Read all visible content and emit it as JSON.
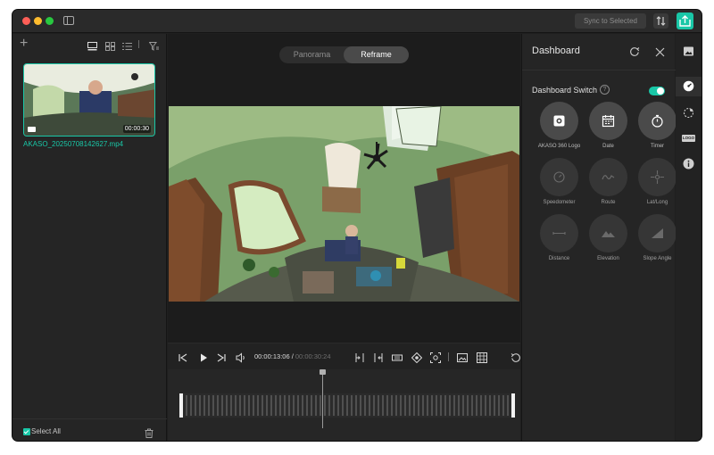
{
  "titlebar": {
    "sync_label": "Sync to Selected"
  },
  "media": {
    "files": [
      {
        "name": "AKASO_20250708142627.mp4",
        "duration": "00:00:30",
        "selected": true
      }
    ],
    "select_all_label": "Select All"
  },
  "viewer": {
    "modes": [
      "Panorama",
      "Reframe"
    ],
    "active_mode": "Reframe"
  },
  "playback": {
    "current_time": "00:00:13:06",
    "separator": " / ",
    "duration": "00:00:30:24"
  },
  "dashboard": {
    "title": "Dashboard",
    "switch_label": "Dashboard Switch",
    "switch_on": true,
    "widgets": [
      {
        "label": "AKASO 360 Logo",
        "icon": "logo-icon",
        "enabled": true
      },
      {
        "label": "Date",
        "icon": "calendar-icon",
        "enabled": true
      },
      {
        "label": "Timer",
        "icon": "stopwatch-icon",
        "enabled": true
      },
      {
        "label": "Speedometer",
        "icon": "speedometer-icon",
        "enabled": false
      },
      {
        "label": "Route",
        "icon": "route-icon",
        "enabled": false
      },
      {
        "label": "Lat/Long",
        "icon": "crosshair-icon",
        "enabled": false
      },
      {
        "label": "Distance",
        "icon": "distance-icon",
        "enabled": false
      },
      {
        "label": "Elevation",
        "icon": "mountain-icon",
        "enabled": false
      },
      {
        "label": "Slope Angle",
        "icon": "slope-icon",
        "enabled": false
      }
    ]
  },
  "rail": {
    "logo_badge": "LOGO",
    "items": [
      "image-icon",
      "dashboard-icon",
      "sticker-icon",
      "logo-icon",
      "info-icon"
    ],
    "active": "dashboard-icon"
  },
  "colors": {
    "accent": "#19c7a7",
    "background": "#1f1f1f",
    "panel": "#252525"
  }
}
